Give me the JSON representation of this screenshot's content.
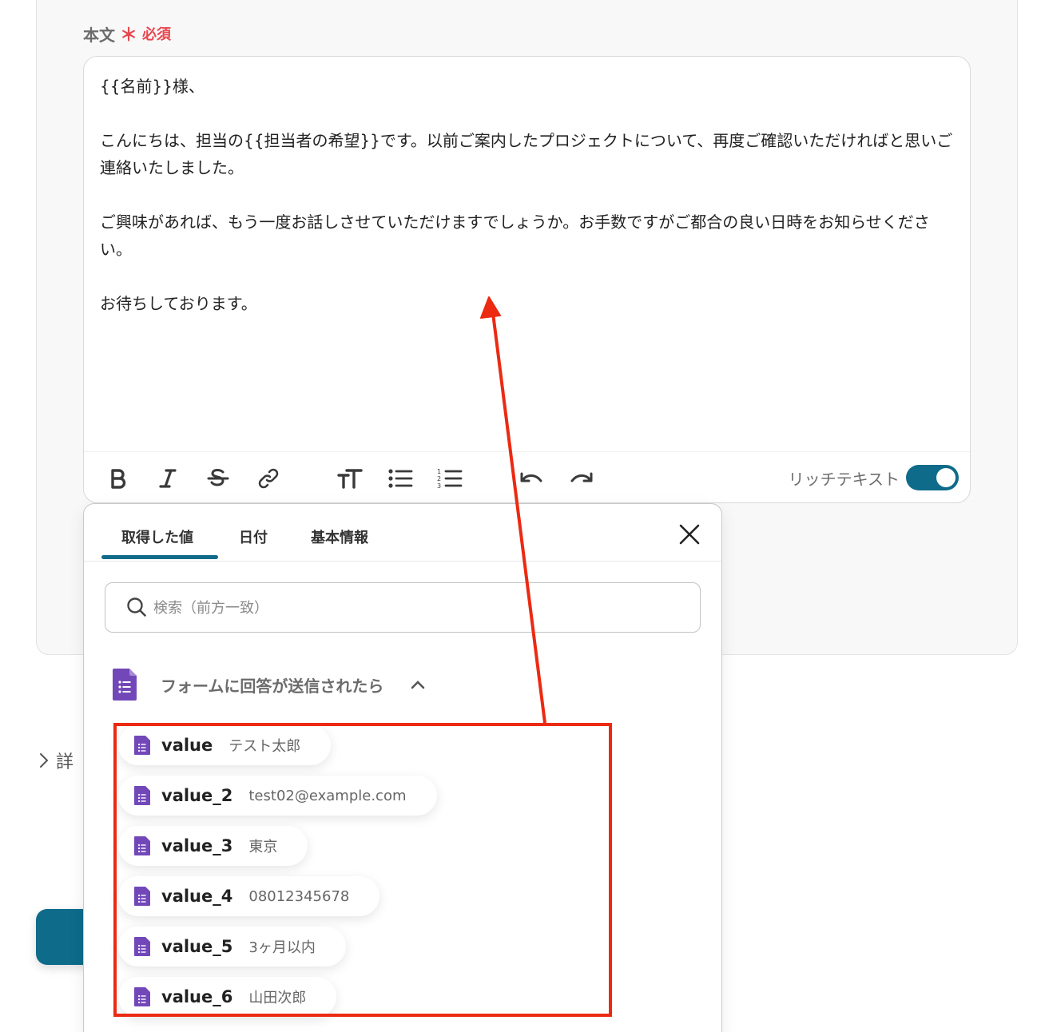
{
  "field": {
    "label": "本文",
    "asterisk": "＊",
    "required": "必須"
  },
  "editor": {
    "lines": [
      "{{名前}}様、",
      "",
      "こんにちは、担当の{{担当者の希望}}です。以前ご案内したプロジェクトについて、再度ご確認いただければと思いご連絡いたしました。",
      "",
      "ご興味があれば、もう一度お話しさせていただけますでしょうか。お手数ですがご都合の良い日時をお知らせください。",
      "",
      "お待ちしております。"
    ],
    "rich_text_label": "リッチテキスト",
    "rich_text_on": true,
    "toolbar_icons": [
      "bold-icon",
      "italic-icon",
      "strikethrough-icon",
      "link-icon",
      "text-size-icon",
      "bullet-list-icon",
      "numbered-list-icon",
      "undo-icon",
      "redo-icon"
    ]
  },
  "details": {
    "label": "詳"
  },
  "popover": {
    "tabs": [
      "取得した値",
      "日付",
      "基本情報"
    ],
    "active_tab": "取得した値",
    "search_placeholder": "検索（前方一致）",
    "section_title": "フォームに回答が送信されたら",
    "items": [
      {
        "key": "value",
        "value": "テスト太郎"
      },
      {
        "key": "value_2",
        "value": "test02@example.com"
      },
      {
        "key": "value_3",
        "value": "東京"
      },
      {
        "key": "value_4",
        "value": "08012345678"
      },
      {
        "key": "value_5",
        "value": "3ヶ月以内"
      },
      {
        "key": "value_6",
        "value": "山田次郎"
      }
    ]
  },
  "colors": {
    "accent": "#0e6b8a",
    "required": "#e8474f",
    "highlight": "#ec2a12",
    "forms_icon": "#7248b9"
  }
}
